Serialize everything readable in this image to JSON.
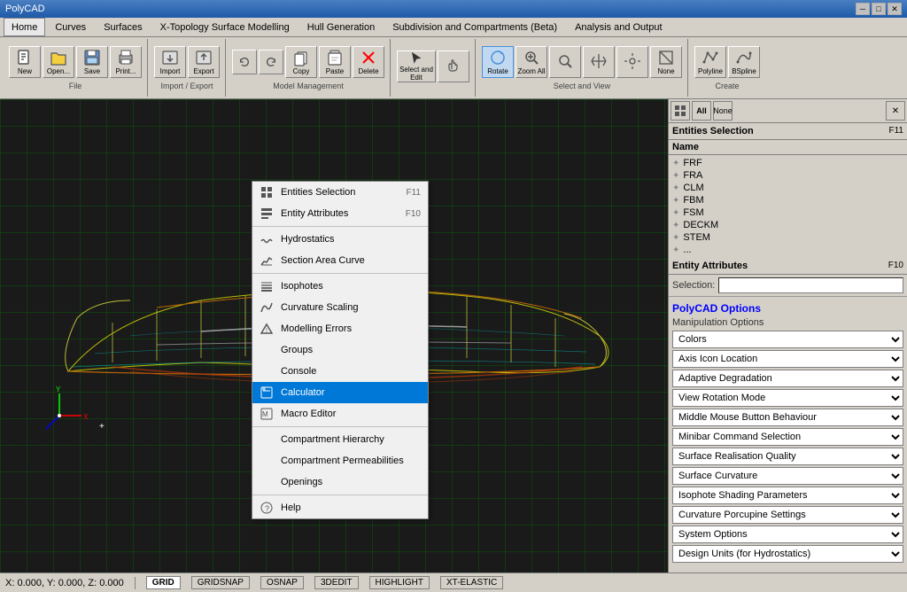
{
  "app": {
    "title": "PolyCAD",
    "window_controls": [
      "minimize",
      "maximize",
      "close"
    ]
  },
  "menu": {
    "items": [
      "Home",
      "Curves",
      "Surfaces",
      "X-Topology Surface Modelling",
      "Hull Generation",
      "Subdivision and Compartments (Beta)",
      "Analysis and Output"
    ]
  },
  "toolbar": {
    "groups": [
      {
        "name": "file",
        "label": "File",
        "buttons": [
          {
            "id": "new",
            "label": "New"
          },
          {
            "id": "open",
            "label": "Open..."
          },
          {
            "id": "save",
            "label": "Save"
          },
          {
            "id": "print",
            "label": "Print..."
          }
        ]
      },
      {
        "name": "import-export",
        "label": "Import / Export",
        "buttons": [
          {
            "id": "import",
            "label": "Import"
          },
          {
            "id": "export",
            "label": "Export"
          }
        ]
      },
      {
        "name": "model-management",
        "label": "Model Management",
        "buttons": [
          {
            "id": "undo",
            "label": ""
          },
          {
            "id": "copy",
            "label": "Copy"
          },
          {
            "id": "paste",
            "label": "Paste"
          },
          {
            "id": "delete",
            "label": "Delete"
          }
        ]
      },
      {
        "name": "select-edit",
        "label": "",
        "buttons": [
          {
            "id": "select-edit",
            "label": "Select and Edit"
          }
        ]
      },
      {
        "name": "select-view",
        "label": "Select and View",
        "buttons": [
          {
            "id": "zoom-all",
            "label": "Zoom All"
          },
          {
            "id": "rotate",
            "label": "Rotate"
          }
        ]
      },
      {
        "name": "create",
        "label": "Create",
        "buttons": [
          {
            "id": "polyline",
            "label": "Polyline"
          },
          {
            "id": "bspline",
            "label": "BSpline"
          }
        ]
      }
    ]
  },
  "right_panel": {
    "entities": {
      "title": "Entities Selection",
      "shortcut": "F11",
      "name_header": "Name",
      "items": [
        {
          "name": "FRF",
          "type": "mesh"
        },
        {
          "name": "FRA",
          "type": "mesh"
        },
        {
          "name": "CLM",
          "type": "mesh"
        },
        {
          "name": "FBM",
          "type": "mesh"
        },
        {
          "name": "FSM",
          "type": "mesh"
        },
        {
          "name": "DECKM",
          "type": "mesh"
        },
        {
          "name": "STEM",
          "type": "mesh"
        },
        {
          "name": "...",
          "type": "mesh"
        }
      ]
    },
    "attributes": {
      "title": "Entity Attributes",
      "shortcut": "F10"
    },
    "selection": {
      "label": "Selection:"
    },
    "options_title": "PolyCAD Options",
    "options_subtitle": "Manipulation Options",
    "dropdowns": [
      {
        "label": "Colors"
      },
      {
        "label": "Axis Icon Location"
      },
      {
        "label": "Adaptive Degradation"
      },
      {
        "label": "View Rotation  Mode"
      },
      {
        "label": "Middle Mouse Button Behaviour"
      },
      {
        "label": "Minibar Command Selection"
      },
      {
        "label": "Surface Realisation Quality"
      },
      {
        "label": "Surface Curvature"
      },
      {
        "label": "Isophote Shading Parameters"
      },
      {
        "label": "Curvature Porcupine Settings"
      },
      {
        "label": "System Options"
      },
      {
        "label": "Design Units (for Hydrostatics)"
      }
    ],
    "compartment_hierarchy": "Compartment Hierarchy"
  },
  "context_menu": {
    "items": [
      {
        "id": "entities-selection",
        "label": "Entities Selection",
        "shortcut": "F11",
        "icon": "grid"
      },
      {
        "id": "entity-attributes",
        "label": "Entity Attributes",
        "shortcut": "F10",
        "icon": "list"
      },
      {
        "id": "hydrostatics",
        "label": "Hydrostatics",
        "shortcut": "",
        "icon": "wave"
      },
      {
        "id": "section-area-curve",
        "label": "Section Area Curve",
        "shortcut": "",
        "icon": "chart"
      },
      {
        "id": "isophotes",
        "label": "Isophotes",
        "shortcut": "",
        "icon": "lines"
      },
      {
        "id": "curvature-scaling",
        "label": "Curvature Scaling",
        "shortcut": "",
        "icon": "curve"
      },
      {
        "id": "modelling-errors",
        "label": "Modelling Errors",
        "shortcut": "",
        "icon": "triangle"
      },
      {
        "id": "groups",
        "label": "Groups",
        "shortcut": "",
        "icon": ""
      },
      {
        "id": "console",
        "label": "Console",
        "shortcut": "",
        "icon": ""
      },
      {
        "id": "calculator",
        "label": "Calculator",
        "shortcut": "",
        "icon": "calc",
        "highlighted": true
      },
      {
        "id": "macro-editor",
        "label": "Macro Editor",
        "shortcut": "",
        "icon": "macro"
      },
      {
        "id": "compartment-hierarchy",
        "label": "Compartment Hierarchy",
        "shortcut": "",
        "icon": ""
      },
      {
        "id": "compartment-permeabilities",
        "label": "Compartment Permeabilities",
        "shortcut": "",
        "icon": ""
      },
      {
        "id": "openings",
        "label": "Openings",
        "shortcut": "",
        "icon": ""
      },
      {
        "id": "help",
        "label": "Help",
        "shortcut": "",
        "icon": "question"
      }
    ]
  },
  "status_bar": {
    "coords": "X: 0.000, Y: 0.000, Z: 0.000",
    "buttons": [
      "GRID",
      "GRIDSNAP",
      "OSNAP",
      "3DEDIT",
      "HIGHLIGHT",
      "XT-ELASTIC"
    ]
  }
}
